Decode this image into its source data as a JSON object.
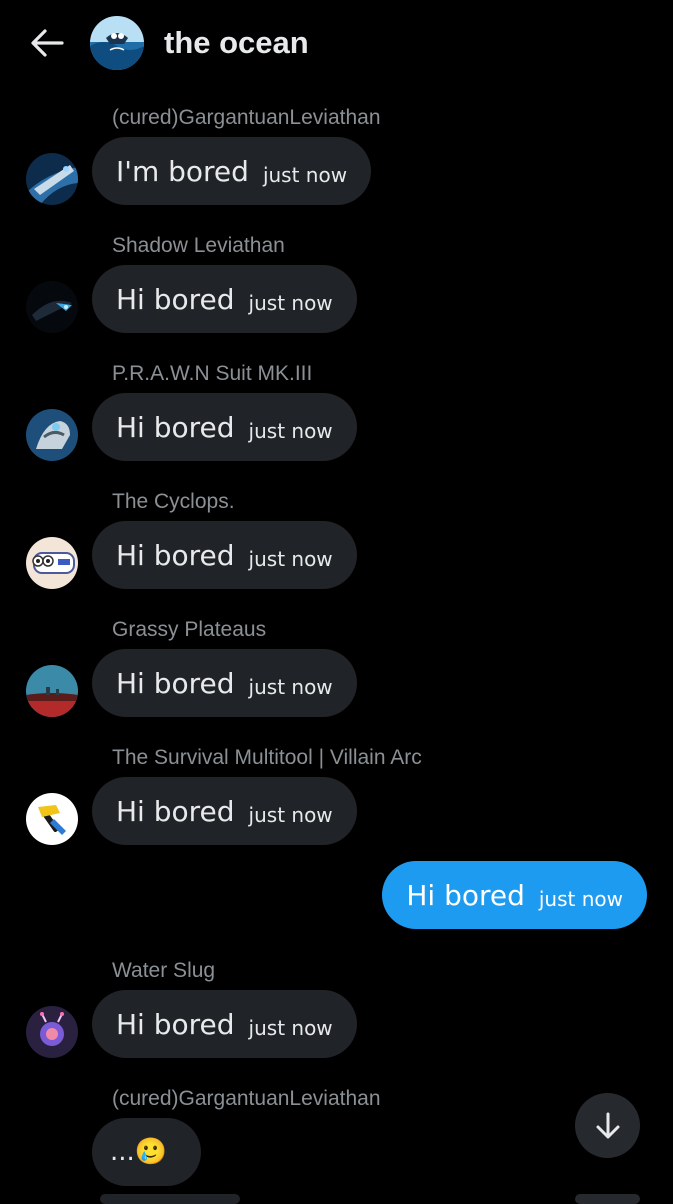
{
  "header": {
    "title": "the ocean",
    "back_icon": "arrow-left-icon",
    "avatar_icon": "group-avatar-ocean"
  },
  "colors": {
    "background": "#000000",
    "bubble_other": "#202327",
    "bubble_own": "#1d9bf0",
    "sender_name": "#8b9095",
    "text": "#e7e9ea"
  },
  "messages": [
    {
      "sender": "(cured)GargantuanLeviathan",
      "text": "I'm bored",
      "time": "just now"
    },
    {
      "sender": "Shadow Leviathan",
      "text": "Hi bored",
      "time": "just now"
    },
    {
      "sender": "P.R.A.W.N Suit MK.III",
      "text": "Hi bored",
      "time": "just now"
    },
    {
      "sender": "The Cyclops.",
      "text": "Hi bored",
      "time": "just now"
    },
    {
      "sender": "Grassy Plateaus",
      "text": "Hi bored",
      "time": "just now"
    },
    {
      "sender": "The Survival Multitool | Villain Arc",
      "text": "Hi bored",
      "time": "just now"
    },
    {
      "sender": "",
      "text": "Hi bored",
      "time": "just now",
      "own": true
    },
    {
      "sender": "Water Slug",
      "text": "Hi bored",
      "time": "just now"
    },
    {
      "sender": "(cured)GargantuanLeviathan",
      "text": "...🥲"
    }
  ],
  "scroll_button": {
    "icon": "arrow-down-icon"
  }
}
